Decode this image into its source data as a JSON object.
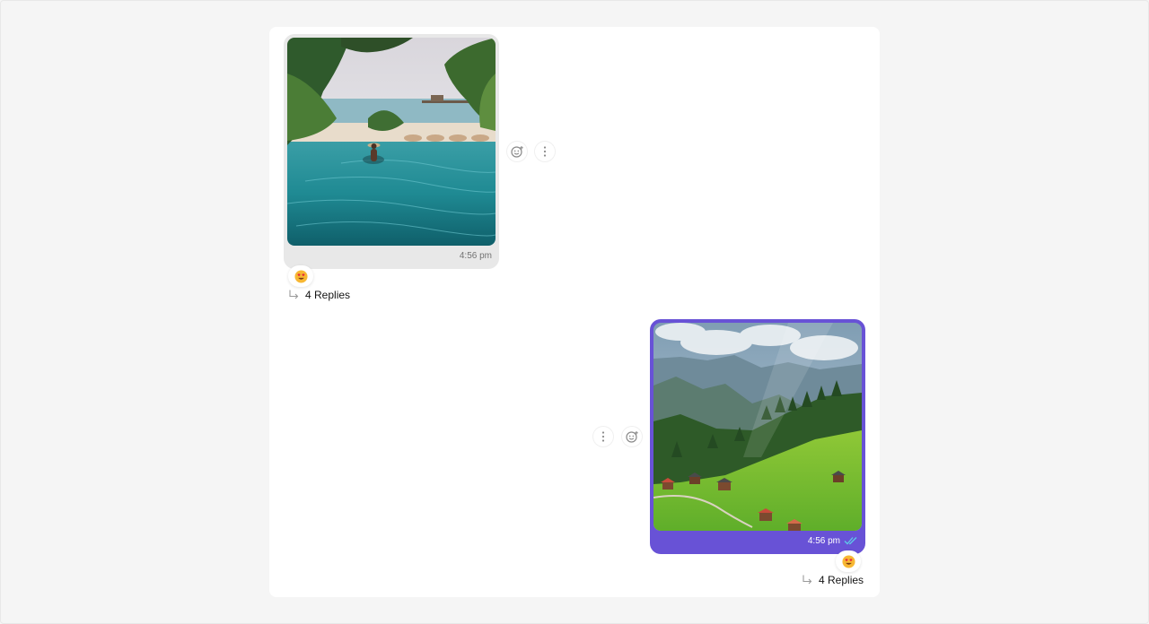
{
  "messages": [
    {
      "direction": "incoming",
      "image_alt": "infinity-pool-photo",
      "time": "4:56 pm",
      "reaction_icon": "heart-eyes-emoji",
      "replies_label": "4 Replies"
    },
    {
      "direction": "outgoing",
      "image_alt": "mountain-valley-photo",
      "time": "4:56 pm",
      "receipt_icon": "double-check-read-icon",
      "reaction_icon": "heart-eyes-emoji",
      "replies_label": "4 Replies"
    }
  ],
  "colors": {
    "outgoing_bubble": "#6852d6",
    "incoming_bubble": "#e8e8e8",
    "read_receipt": "#5ec9e8"
  }
}
